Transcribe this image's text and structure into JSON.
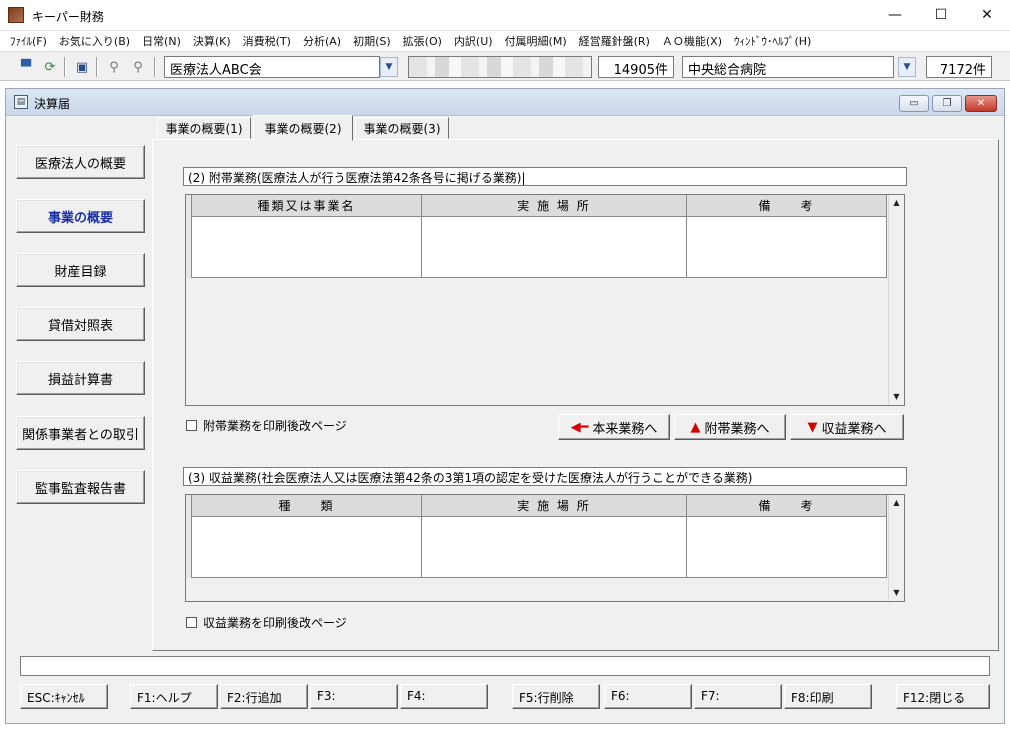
{
  "app": {
    "title": "キーパー財務"
  },
  "window_controls": {
    "minimize": "—",
    "maximize": "☐",
    "close": "✕"
  },
  "menu": [
    "ﾌｧｲﾙ(F)",
    "お気に入り(B)",
    "日常(N)",
    "決算(K)",
    "消費税(T)",
    "分析(A)",
    "初期(S)",
    "拡張(O)",
    "内訳(U)",
    "付属明細(M)",
    "経営羅針盤(R)",
    "ＡＯ機能(X)",
    "ｳｨﾝﾄﾞｳ･ﾍﾙﾌﾟ(H)"
  ],
  "toolbar": {
    "company_select": "医療法人ABC会",
    "company_count": "14905件",
    "office_select": "中央総合病院",
    "office_count": "7172件"
  },
  "child": {
    "title": "決算届",
    "controls": {
      "minimize": "▭",
      "restore": "❐",
      "close": "✕"
    }
  },
  "nav": [
    "医療法人の概要",
    "事業の概要",
    "財産目録",
    "貸借対照表",
    "損益計算書",
    "関係事業者との取引",
    "監事監査報告書"
  ],
  "tabs": [
    "事業の概要(1)",
    "事業の概要(2)",
    "事業の概要(3)"
  ],
  "section2": {
    "title": "(2) 附帯業務(医療法人が行う医療法第42条各号に掲げる業務)|",
    "headers": [
      "種類又は事業名",
      "実 施 場 所",
      "備　　考"
    ],
    "print_checkbox": "附帯業務を印刷後改ページ"
  },
  "move_buttons": [
    "本来業務へ",
    "附帯業務へ",
    "収益業務へ"
  ],
  "section3": {
    "title": "(3) 収益業務(社会医療法人又は医療法第42条の3第1項の認定を受けた医療法人が行うことができる業務)",
    "headers": [
      "種　　類",
      "実 施 場 所",
      "備　　考"
    ],
    "print_checkbox": "収益業務を印刷後改ページ"
  },
  "fkeys": [
    "ESC:ｷｬﾝｾﾙ",
    "F1:ヘルプ",
    "F2:行追加",
    "F3:",
    "F4:",
    "F5:行削除",
    "F6:",
    "F7:",
    "F8:印刷",
    "F12:閉じる"
  ]
}
